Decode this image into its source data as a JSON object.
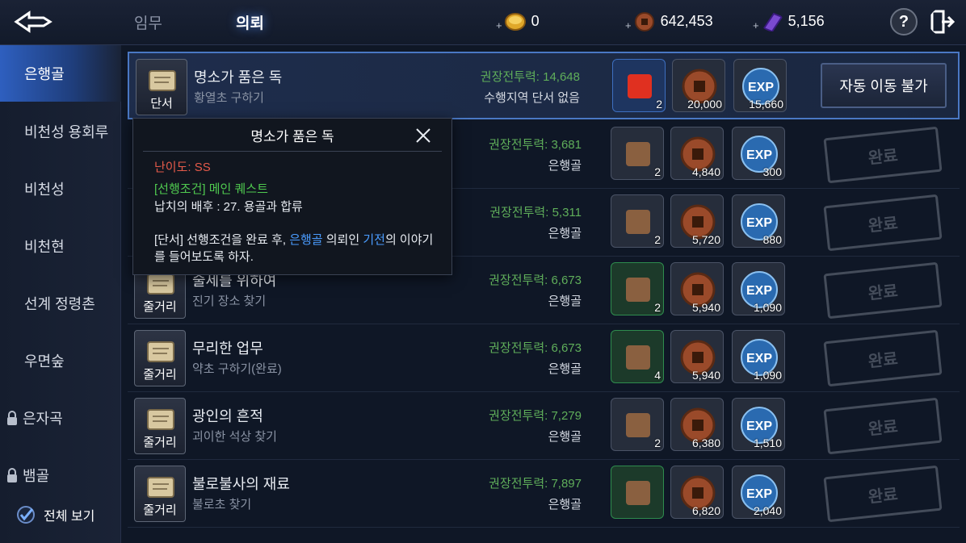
{
  "header": {
    "tabs": [
      {
        "label": "임무"
      },
      {
        "label": "의뢰"
      }
    ],
    "currencies": [
      {
        "icon": "gold-coin-icon",
        "value": "0"
      },
      {
        "icon": "bronze-coin-icon",
        "value": "642,453"
      },
      {
        "icon": "purple-crystal-icon",
        "value": "5,156"
      }
    ],
    "help": "?"
  },
  "sidebar": {
    "items": [
      {
        "label": "은행골"
      },
      {
        "label": "비천성 용회루"
      },
      {
        "label": "비천성"
      },
      {
        "label": "비천현"
      },
      {
        "label": "선계 정령촌"
      },
      {
        "label": "우면숲"
      },
      {
        "label": "은자곡"
      },
      {
        "label": "뱀골"
      }
    ],
    "view_all": "전체 보기"
  },
  "quests": [
    {
      "type": "단서",
      "title": "명소가 품은 독",
      "sub": "황열초 구하기",
      "power": "권장전투력: 14,648",
      "loc": "수행지역 단서 없음",
      "r1": "2",
      "r2": "20,000",
      "r3": "15,660",
      "action": "자동 이동 불가"
    },
    {
      "type": "",
      "title": "",
      "sub": "",
      "power": "권장전투력: 3,681",
      "loc": "은행골",
      "r1": "2",
      "r2": "4,840",
      "r3": "300",
      "action": "완료"
    },
    {
      "type": "",
      "title": "",
      "sub": "",
      "power": "권장전투력: 5,311",
      "loc": "은행골",
      "r1": "2",
      "r2": "5,720",
      "r3": "880",
      "action": "완료"
    },
    {
      "type": "줄거리",
      "title": "술세를 위하여",
      "sub": "진기 장소 찾기",
      "power": "권장전투력: 6,673",
      "loc": "은행골",
      "r1": "2",
      "r2": "5,940",
      "r3": "1,090",
      "action": "완료"
    },
    {
      "type": "줄거리",
      "title": "무리한 업무",
      "sub": "약초 구하기(완료)",
      "power": "권장전투력: 6,673",
      "loc": "은행골",
      "r1": "4",
      "r2": "5,940",
      "r3": "1,090",
      "action": "완료"
    },
    {
      "type": "줄거리",
      "title": "광인의 흔적",
      "sub": "괴이한 석상 찾기",
      "power": "권장전투력: 7,279",
      "loc": "은행골",
      "r1": "2",
      "r2": "6,380",
      "r3": "1,510",
      "action": "완료"
    },
    {
      "type": "줄거리",
      "title": "불로불사의 재료",
      "sub": "불로초 찾기",
      "power": "권장전투력: 7,897",
      "loc": "은행골",
      "r1": "",
      "r2": "6,820",
      "r3": "2,040",
      "action": "완료"
    }
  ],
  "popup": {
    "title": "명소가 품은 독",
    "difficulty": "난이도: SS",
    "prereq": "[선행조건] 메인 퀘스트",
    "prereq2": "납치의 배후 : 27. 용골과 합류",
    "desc_a": "[단서] 선행조건을 완료 후, ",
    "desc_b": "은행골",
    "desc_c": " 의뢰인 ",
    "desc_d": "기전",
    "desc_e": "의 이야기를 들어보도록 하자."
  },
  "colors": {
    "accent": "#2e5fbf",
    "power": "#5fae5a",
    "difficulty": "#e55a4a",
    "prereq": "#4fc94f",
    "link": "#4a9cff"
  }
}
